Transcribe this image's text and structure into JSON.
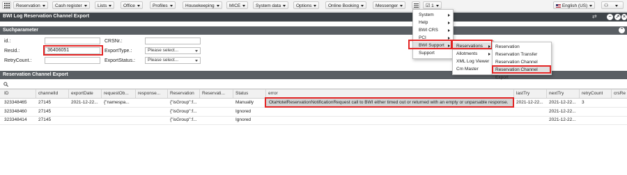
{
  "menubar": {
    "items": [
      {
        "label": "Reservation"
      },
      {
        "label": "Cash register"
      },
      {
        "label": "Lists"
      },
      {
        "label": "Office"
      },
      {
        "label": "Profiles"
      },
      {
        "label": "Housekeeping"
      },
      {
        "label": "MICE"
      },
      {
        "label": "System data"
      },
      {
        "label": "Options"
      },
      {
        "label": "Online Booking"
      },
      {
        "label": "Messenger"
      }
    ],
    "task_count": "1",
    "language": "English (US)"
  },
  "window": {
    "title": "BWI Log Reservation Channel Export"
  },
  "search": {
    "title": "Suchparameter",
    "id_label": "id.:",
    "id_value": "",
    "resid_label": "ResId.:",
    "resid_value": "36406051",
    "retry_label": "RetryCount.:",
    "retry_value": "",
    "crs_label": "CRSNr.:",
    "crs_value": "",
    "exporttype_label": "ExportType.:",
    "exporttype_value": "Please select...",
    "exportstatus_label": "ExportStatus.:",
    "exportstatus_value": "Please select..."
  },
  "grid": {
    "title": "Reservation Channel Export",
    "columns": [
      "ID",
      "channelId",
      "exportDate",
      "requestOb...",
      "response...",
      "Reservation",
      "Reservati...",
      "Status",
      "error",
      "lastTry",
      "nextTry",
      "retryCount",
      "crsRe"
    ],
    "rows": [
      {
        "id": "323348465",
        "channel": "27145",
        "date": "2021-12-22...",
        "request": "{\"namespa...",
        "response": "",
        "reservation": "{\"isGroup\":f...",
        "reservati": "",
        "status": "Manually",
        "error": "OtaHotelReservationNotificationRequest call to BWI either timed out or returned with an empty or unparsable response.",
        "lasttry": "2021-12-22...",
        "nexttry": "2021-12-22...",
        "retry": "3"
      },
      {
        "id": "323348460",
        "channel": "27145",
        "date": "",
        "request": "",
        "response": "",
        "reservation": "{\"isGroup\":f...",
        "reservati": "",
        "status": "Ignored",
        "error": "",
        "lasttry": "",
        "nexttry": "2021-12-22...",
        "retry": ""
      },
      {
        "id": "323348414",
        "channel": "27145",
        "date": "",
        "request": "",
        "response": "",
        "reservation": "{\"isGroup\":f...",
        "reservati": "",
        "status": "Ignored",
        "error": "",
        "lasttry": "",
        "nexttry": "2021-12-22...",
        "retry": ""
      }
    ]
  },
  "menu_options": {
    "items": [
      "System",
      "Help",
      "BWI CRS",
      "PCI",
      "BWI Support",
      "Support"
    ]
  },
  "menu_bwi": {
    "items": [
      "Reservations",
      "Allotments",
      "XML Log Viewer",
      "Cm Master"
    ]
  },
  "menu_reservations": {
    "items": [
      "Reservation",
      "Reservation Transfer",
      "Reservation Channel Import",
      "Reservation Channel Export"
    ]
  },
  "colors": {
    "highlight_red": "#e32424",
    "title_bar": "#3f4449",
    "section_bar": "#5a5f64"
  }
}
